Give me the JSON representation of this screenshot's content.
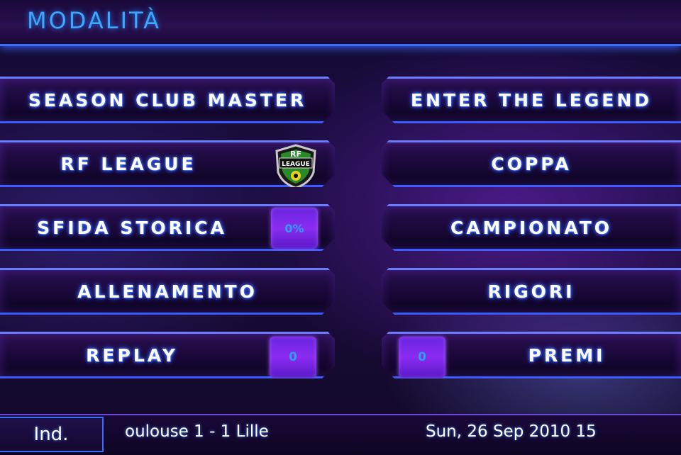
{
  "header": {
    "title": "MODALITÀ"
  },
  "menu": {
    "left": [
      {
        "label": "SEASON CLUB MASTER"
      },
      {
        "label": "RF LEAGUE",
        "logo_text_top": "RF",
        "logo_text_bottom": "LEAGUE",
        "logo_icon": "rf-league-shield-icon"
      },
      {
        "label": "SFIDA STORICA",
        "badge": "0%"
      },
      {
        "label": "ALLENAMENTO"
      },
      {
        "label": "REPLAY",
        "badge": "0"
      }
    ],
    "right": [
      {
        "label": "ENTER THE LEGEND"
      },
      {
        "label": "COPPA"
      },
      {
        "label": "CAMPIONATO"
      },
      {
        "label": "RIGORI"
      },
      {
        "label": "PREMI",
        "badge": "0"
      }
    ]
  },
  "footer": {
    "back_label": "Ind.",
    "ticker": "oulouse 1 - 1 Lille",
    "datetime": "Sun, 26 Sep 2010 15"
  },
  "colors": {
    "accent_blue": "#3aa8ff",
    "badge_purple": "#7a28e8",
    "border_blue": "#3a5cff"
  }
}
